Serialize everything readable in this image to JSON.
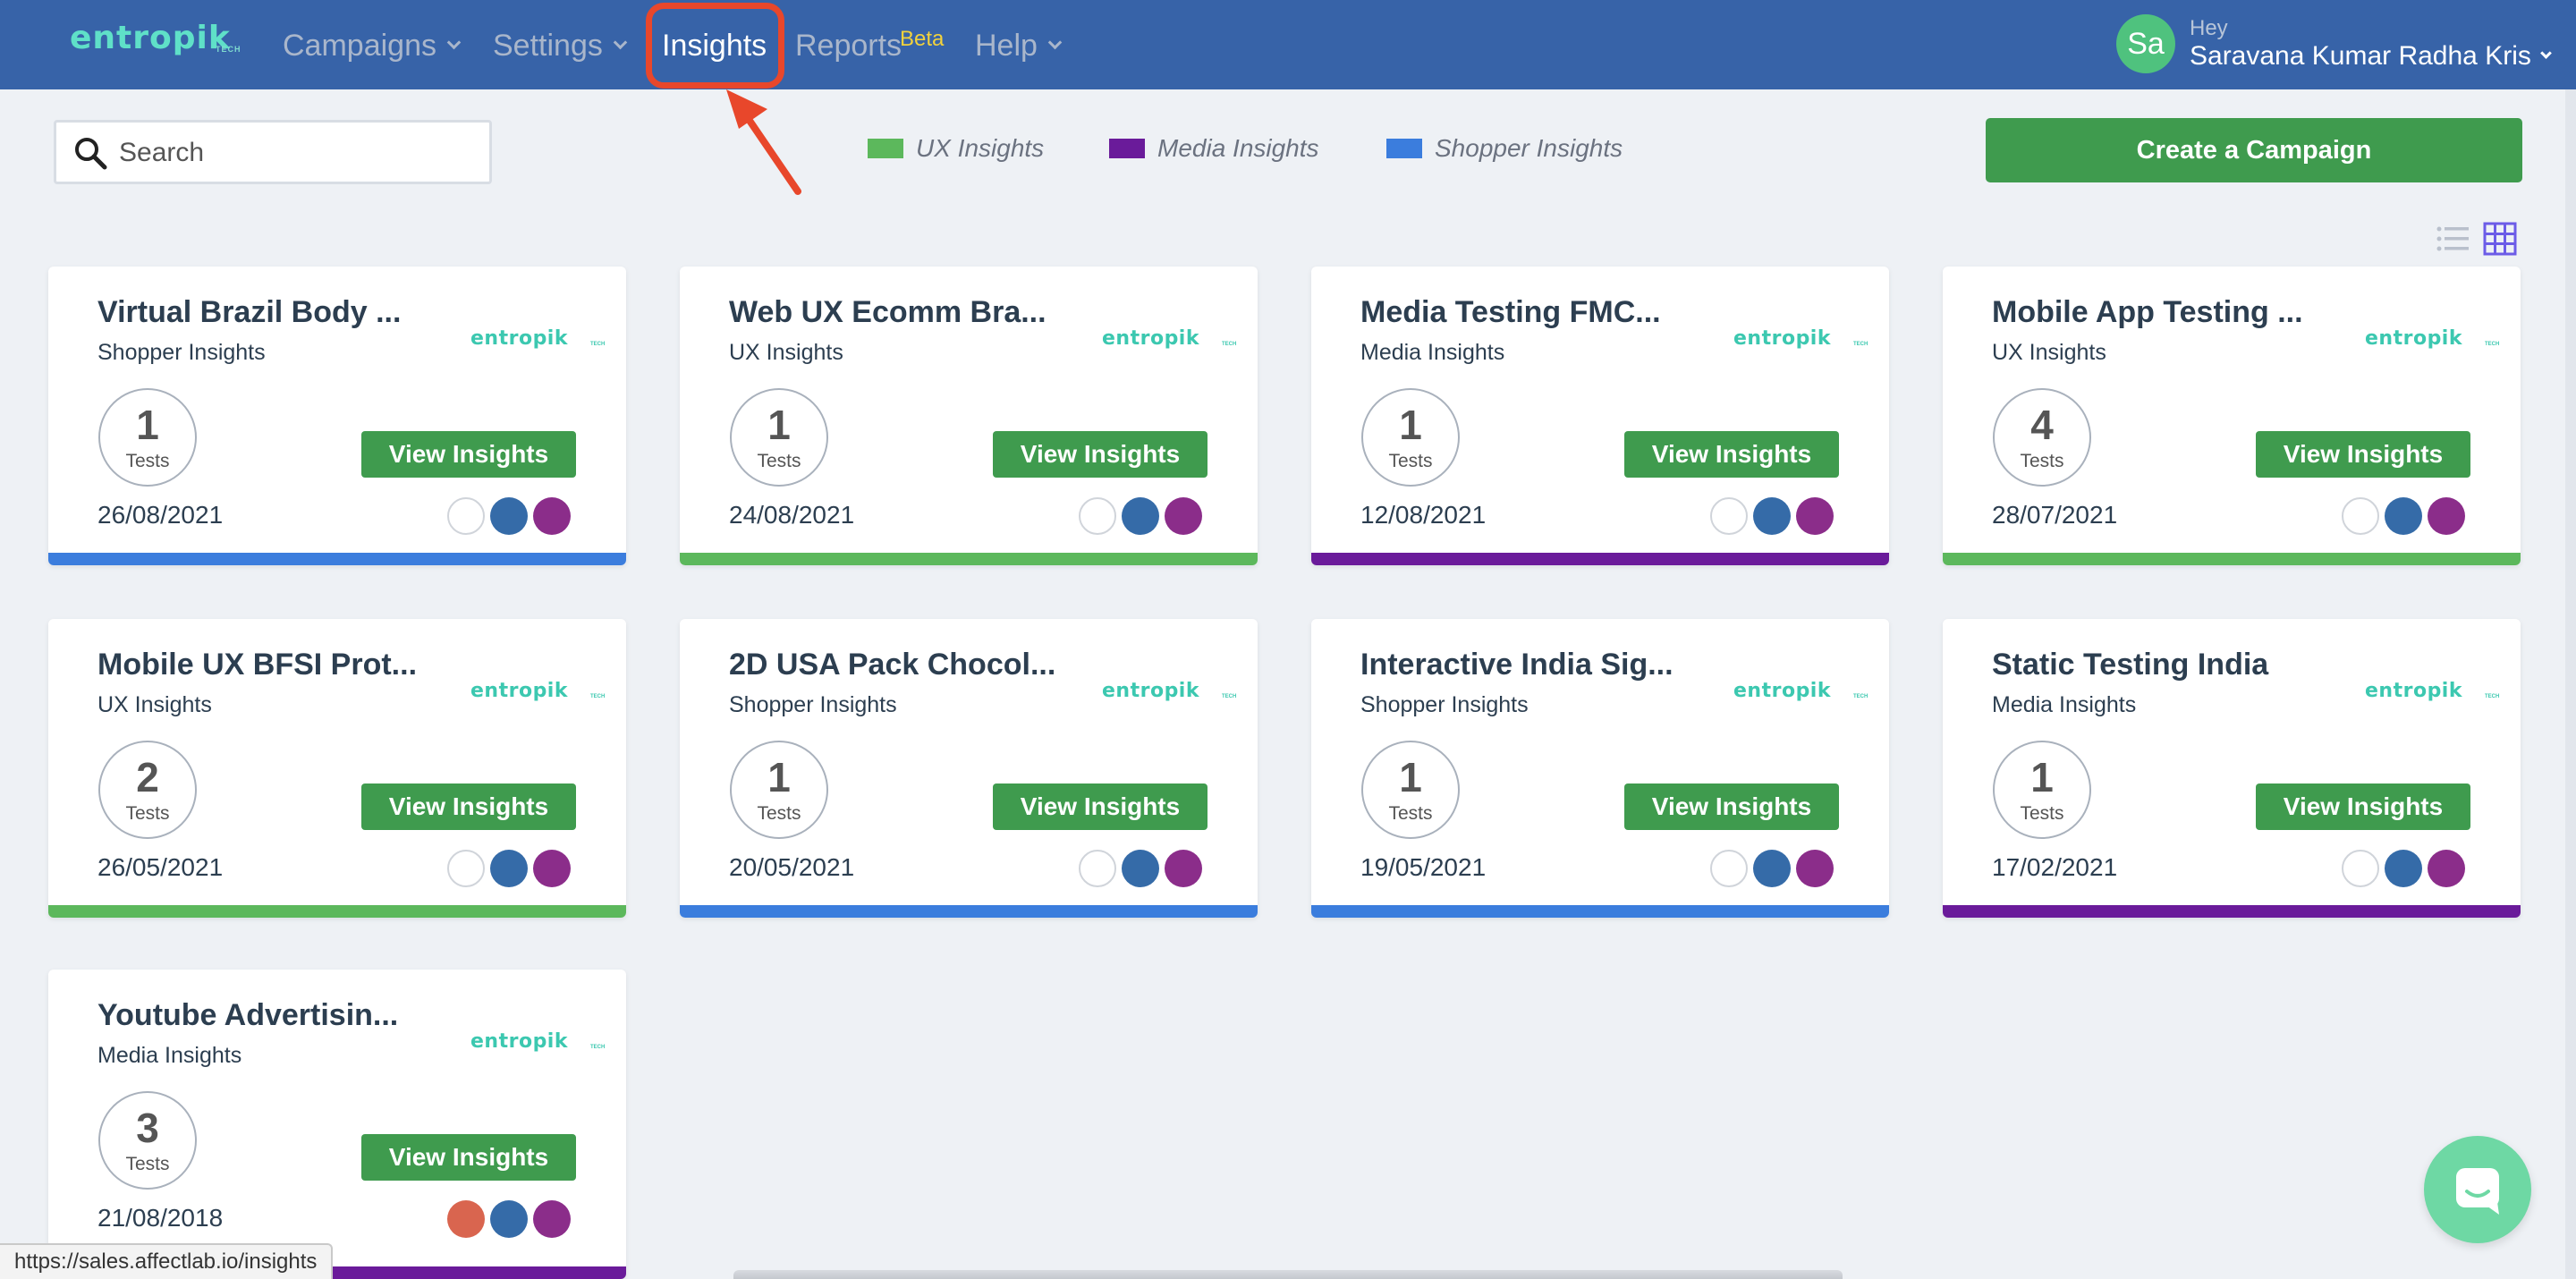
{
  "navbar": {
    "logo": "entropik",
    "logo_sub": "TECH",
    "items": [
      {
        "label": "Campaigns"
      },
      {
        "label": "Settings"
      },
      {
        "label": "Insights"
      },
      {
        "label": "Reports",
        "badge": "Beta"
      },
      {
        "label": "Help"
      }
    ],
    "user": {
      "initials": "Sa",
      "greeting": "Hey",
      "name": "Saravana Kumar Radha Kris"
    }
  },
  "toolbar": {
    "search_placeholder": "Search",
    "legend": [
      {
        "label": "UX Insights",
        "color": "#5cb85c"
      },
      {
        "label": "Media Insights",
        "color": "#6a1b9a"
      },
      {
        "label": "Shopper Insights",
        "color": "#3b7ddd"
      }
    ],
    "create_label": "Create a Campaign"
  },
  "cards": [
    {
      "title": "Virtual Brazil Body ...",
      "type": "Shopper Insights",
      "tests": "1",
      "tests_label": "Tests",
      "button": "View Insights",
      "date": "26/08/2021",
      "bar_color": "#3b7ddd"
    },
    {
      "title": "Web UX Ecomm Bra...",
      "type": "UX Insights",
      "tests": "1",
      "tests_label": "Tests",
      "button": "View Insights",
      "date": "24/08/2021",
      "bar_color": "#5cb85c"
    },
    {
      "title": "Media Testing FMC...",
      "type": "Media Insights",
      "tests": "1",
      "tests_label": "Tests",
      "button": "View Insights",
      "date": "12/08/2021",
      "bar_color": "#6a1b9a"
    },
    {
      "title": "Mobile App Testing ...",
      "type": "UX Insights",
      "tests": "4",
      "tests_label": "Tests",
      "button": "View Insights",
      "date": "28/07/2021",
      "bar_color": "#5cb85c"
    },
    {
      "title": "Mobile UX BFSI Prot...",
      "type": "UX Insights",
      "tests": "2",
      "tests_label": "Tests",
      "button": "View Insights",
      "date": "26/05/2021",
      "bar_color": "#5cb85c"
    },
    {
      "title": "2D USA Pack Chocol...",
      "type": "Shopper Insights",
      "tests": "1",
      "tests_label": "Tests",
      "button": "View Insights",
      "date": "20/05/2021",
      "bar_color": "#3b7ddd"
    },
    {
      "title": "Interactive India Sig...",
      "type": "Shopper Insights",
      "tests": "1",
      "tests_label": "Tests",
      "button": "View Insights",
      "date": "19/05/2021",
      "bar_color": "#3b7ddd"
    },
    {
      "title": "Static Testing India",
      "type": "Media Insights",
      "tests": "1",
      "tests_label": "Tests",
      "button": "View Insights",
      "date": "17/02/2021",
      "bar_color": "#6a1b9a"
    },
    {
      "title": "Youtube Advertisin...",
      "type": "Media Insights",
      "tests": "3",
      "tests_label": "Tests",
      "button": "View Insights",
      "date": "21/08/2018",
      "bar_color": "#6a1b9a"
    }
  ],
  "status_url": "https://sales.affectlab.io/insights"
}
